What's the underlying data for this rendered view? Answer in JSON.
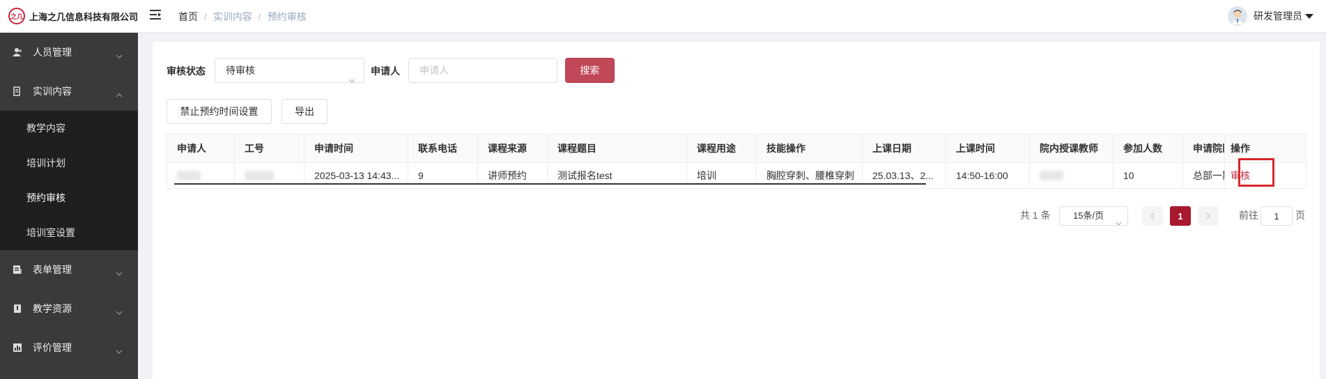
{
  "header": {
    "company": "上海之几信息科技有限公司",
    "logo_mark": "之几",
    "breadcrumb": [
      "首页",
      "实训内容",
      "预约审核"
    ],
    "user_name": "研发管理员"
  },
  "sidebar": {
    "items": [
      {
        "label": "人员管理",
        "icon": "person-icon",
        "expanded": false
      },
      {
        "label": "实训内容",
        "icon": "document-icon",
        "expanded": true,
        "children": [
          {
            "label": "教学内容",
            "active": false
          },
          {
            "label": "培训计划",
            "active": false
          },
          {
            "label": "预约审核",
            "active": true
          },
          {
            "label": "培训室设置",
            "active": false
          }
        ]
      },
      {
        "label": "表单管理",
        "icon": "form-icon",
        "expanded": false
      },
      {
        "label": "教学资源",
        "icon": "resource-icon",
        "expanded": false
      },
      {
        "label": "评价管理",
        "icon": "chart-icon",
        "expanded": false
      }
    ]
  },
  "filters": {
    "status_label": "审核状态",
    "status_value": "待审核",
    "applicant_label": "申请人",
    "applicant_placeholder": "申请人",
    "search_label": "搜索"
  },
  "toolbar": {
    "disable_time_label": "禁止预约时间设置",
    "export_label": "导出"
  },
  "table": {
    "columns": [
      "申请人",
      "工号",
      "申请时间",
      "联系电话",
      "课程来源",
      "课程题目",
      "课程用途",
      "技能操作",
      "上课日期",
      "上课时间",
      "院内授课教师",
      "参加人数",
      "申请院区",
      "操作"
    ],
    "rows": [
      {
        "申请时间": "2025-03-13 14:43...",
        "联系电话": "9",
        "课程来源": "讲师预约",
        "课程题目": "测试报名test",
        "课程用途": "培训",
        "技能操作": "胸腔穿刺、腰椎穿刺",
        "上课日期": "25.03.13、2...",
        "上课时间": "14:50-16:00",
        "参加人数": "10",
        "申请院区": "总部一期",
        "操作": "审核"
      }
    ]
  },
  "pagination": {
    "total_text": "共 1 条",
    "page_size": "15条/页",
    "current_page": "1",
    "goto_prefix": "前往",
    "goto_value": "1",
    "goto_suffix": "页"
  },
  "colors": {
    "accent": "#a8182f",
    "search_button": "#c04858",
    "sidebar_bg": "#3a3a3a",
    "submenu_bg": "#1f1f1f",
    "highlight": "#d9262a"
  }
}
